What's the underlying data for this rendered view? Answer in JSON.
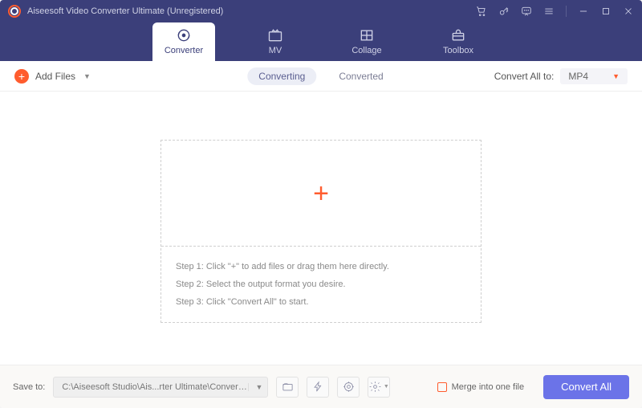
{
  "titlebar": {
    "title": "Aiseesoft Video Converter Ultimate (Unregistered)"
  },
  "nav": {
    "converter": "Converter",
    "mv": "MV",
    "collage": "Collage",
    "toolbox": "Toolbox"
  },
  "toolbar": {
    "add_files": "Add Files",
    "converting": "Converting",
    "converted": "Converted",
    "convert_all_to": "Convert All to:",
    "format": "MP4"
  },
  "dropzone": {
    "step1": "Step 1: Click \"+\" to add files or drag them here directly.",
    "step2": "Step 2: Select the output format you desire.",
    "step3": "Step 3: Click \"Convert All\" to start."
  },
  "footer": {
    "save_to_label": "Save to:",
    "save_to_path": "C:\\Aiseesoft Studio\\Ais...rter Ultimate\\Converted",
    "merge_label": "Merge into one file",
    "convert_button": "Convert All"
  }
}
